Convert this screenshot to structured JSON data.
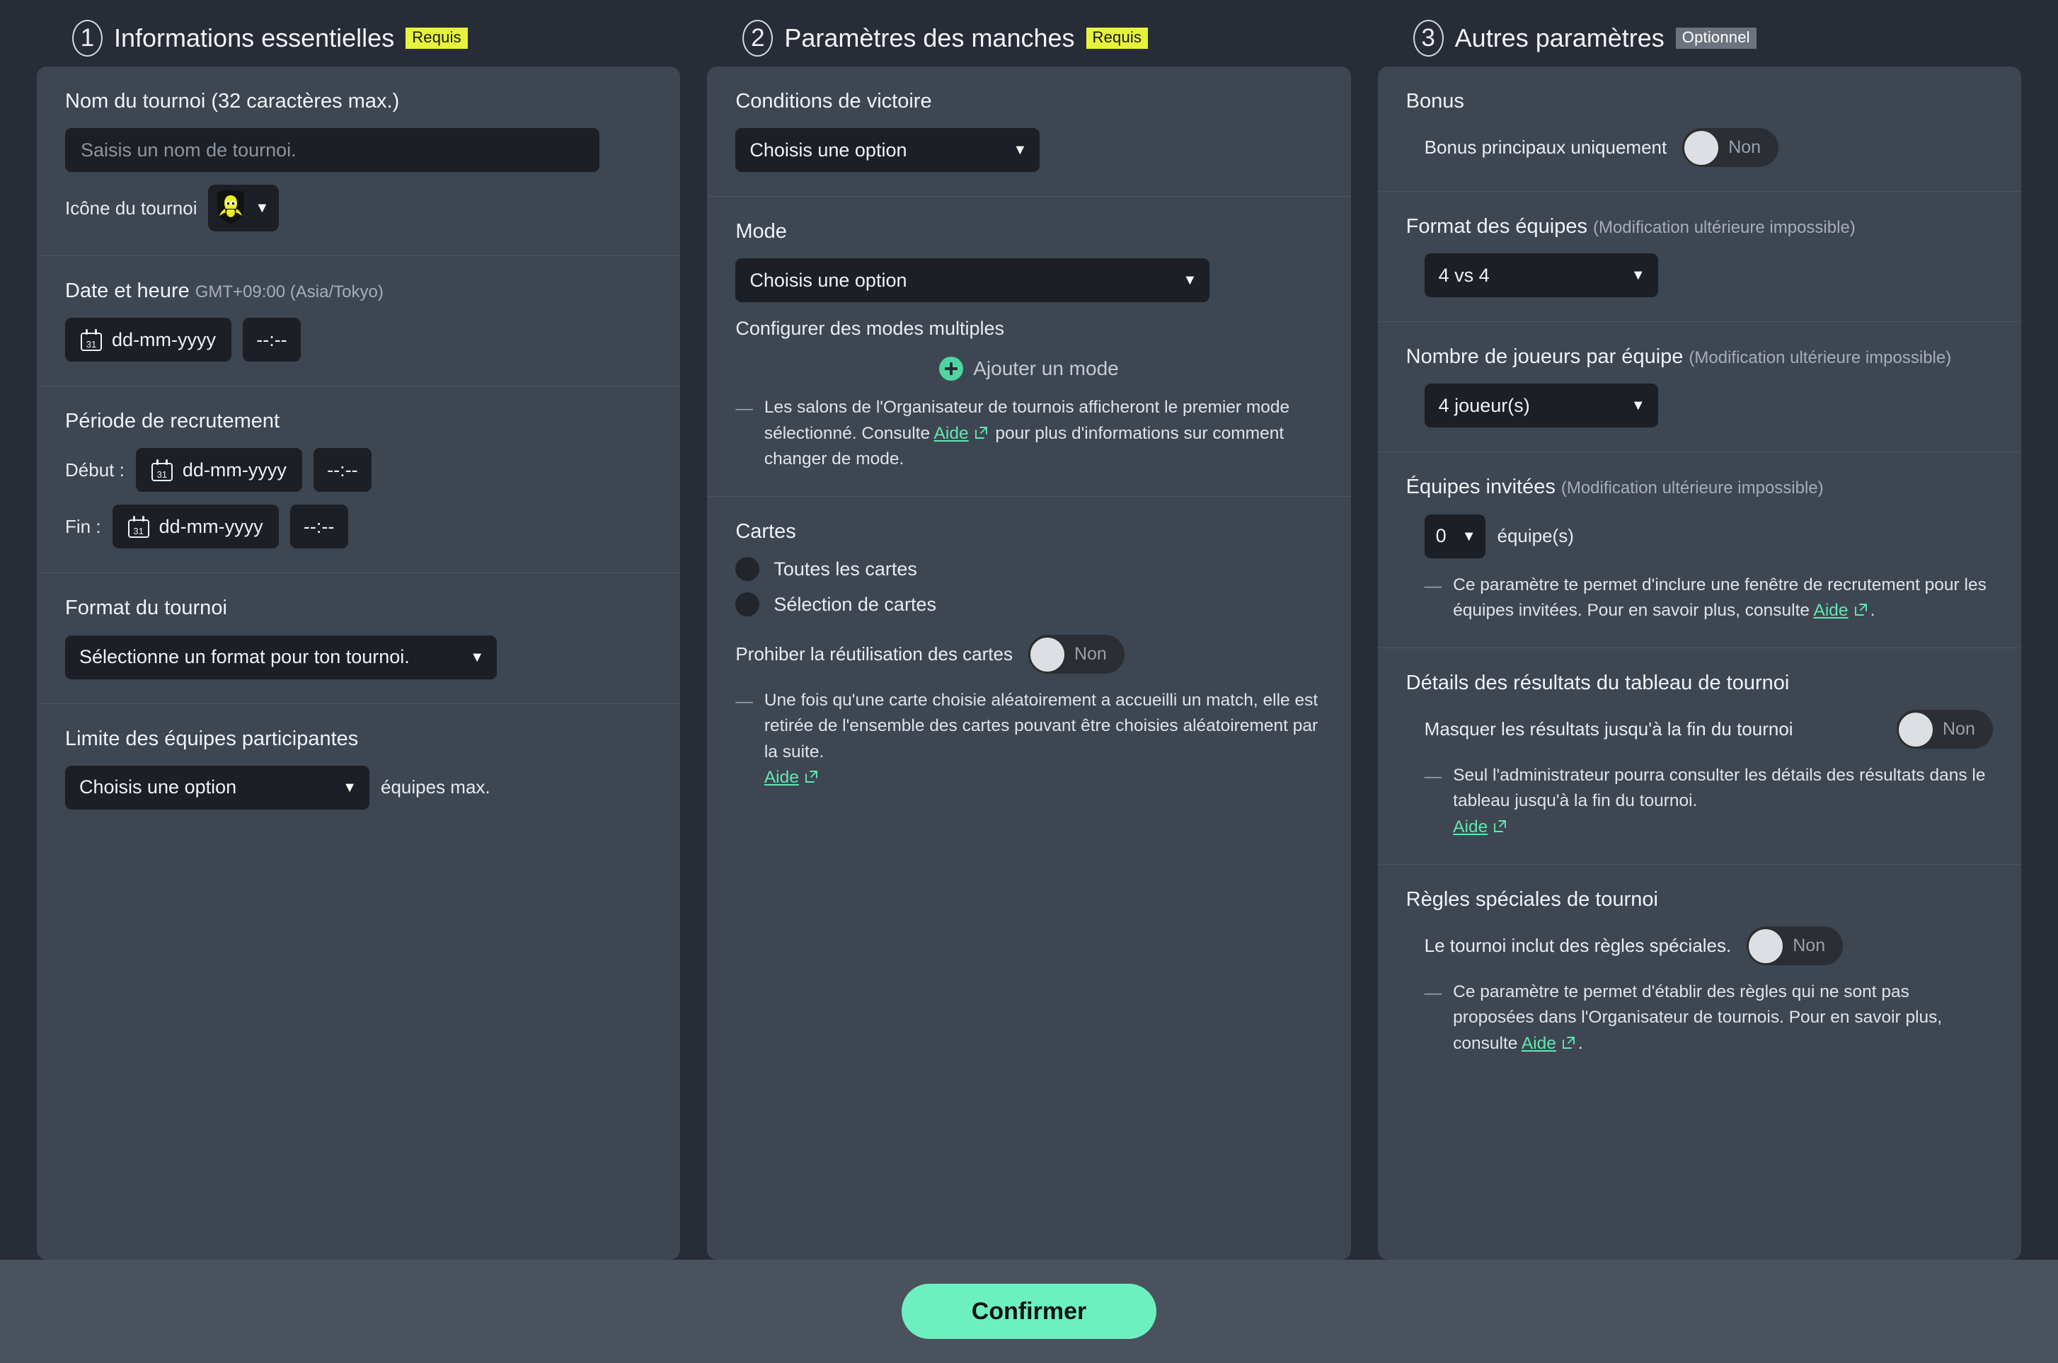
{
  "sections": [
    {
      "number": "1",
      "title": "Informations essentielles",
      "badge": "Requis"
    },
    {
      "number": "2",
      "title": "Paramètres des manches",
      "badge": "Requis"
    },
    {
      "number": "3",
      "title": "Autres paramètres",
      "badge": "Optionnel"
    }
  ],
  "col1": {
    "name": {
      "title": "Nom du tournoi (32 caractères max.)",
      "placeholder": "Saisis un nom de tournoi.",
      "value": "",
      "icon_label": "Icône du tournoi",
      "icon_caret": "▼"
    },
    "datetime": {
      "title": "Date et heure",
      "timezone": "GMT+09:00 (Asia/Tokyo)",
      "date_placeholder": "dd-mm-yyyy",
      "time_placeholder": "--:--",
      "calendar_day": "31"
    },
    "recruitment": {
      "title": "Période de recrutement",
      "start_label": "Début :",
      "end_label": "Fin :",
      "date_placeholder": "dd-mm-yyyy",
      "time_placeholder": "--:--",
      "calendar_day": "31"
    },
    "format": {
      "title": "Format du tournoi",
      "value": "Sélectionne un format pour ton tournoi.",
      "caret": "▼"
    },
    "teamlimit": {
      "title": "Limite des équipes participantes",
      "value": "Choisis une option",
      "caret": "▼",
      "suffix": "équipes max."
    }
  },
  "col2": {
    "victory": {
      "title": "Conditions de victoire",
      "value": "Choisis une option",
      "caret": "▼"
    },
    "mode": {
      "title": "Mode",
      "value": "Choisis une option",
      "caret": "▼",
      "multi_label": "Configurer des modes multiples",
      "add_label": "Ajouter un mode",
      "note_before": "Les salons de l'Organisateur de tournois afficheront le premier mode sélectionné. Consulte ",
      "note_link": "Aide",
      "note_after": " pour plus d'informations sur comment changer de mode."
    },
    "cards": {
      "title": "Cartes",
      "option_all": "Toutes les cartes",
      "option_selection": "Sélection de cartes",
      "prohibit_label": "Prohiber la réutilisation des cartes",
      "prohibit_state": "Non",
      "note": "Une fois qu'une carte choisie aléatoirement a accueilli un match, elle est retirée de l'ensemble des cartes pouvant être choisies aléatoirement par la suite.",
      "note_link": "Aide"
    }
  },
  "col3": {
    "bonus": {
      "title": "Bonus",
      "label": "Bonus principaux uniquement",
      "state": "Non"
    },
    "team_format": {
      "title": "Format des équipes",
      "sub": "(Modification ultérieure impossible)",
      "value": "4 vs 4",
      "caret": "▼"
    },
    "players_per_team": {
      "title": "Nombre de joueurs par équipe",
      "sub": "(Modification ultérieure impossible)",
      "value": "4 joueur(s)",
      "caret": "▼"
    },
    "invited_teams": {
      "title": "Équipes invitées",
      "sub": "(Modification ultérieure impossible)",
      "value": "0",
      "caret": "▼",
      "suffix": "équipe(s)",
      "note_before": "Ce paramètre te permet d'inclure une fenêtre de recrutement pour les équipes invitées. Pour en savoir plus, consulte ",
      "note_link": "Aide",
      "note_after": "."
    },
    "results": {
      "title": "Détails des résultats du tableau de tournoi",
      "label": "Masquer les résultats jusqu'à la fin du tournoi",
      "state": "Non",
      "note": "Seul l'administrateur pourra consulter les détails des résultats dans le tableau jusqu'à la fin du tournoi.",
      "note_link": "Aide"
    },
    "special_rules": {
      "title": "Règles spéciales de tournoi",
      "label": "Le tournoi inclut des règles spéciales.",
      "state": "Non",
      "note_before": "Ce paramètre te permet d'établir des règles qui ne sont pas proposées dans l'Organisateur de tournois. Pour en savoir plus, consulte ",
      "note_link": "Aide",
      "note_after": "."
    }
  },
  "footer": {
    "confirm_label": "Confirmer"
  },
  "colors": {
    "page_bg": "#282c36",
    "card_bg": "#3e4651",
    "field_bg": "#1c1f25",
    "accent_green": "#6df0bf",
    "link_green": "#5fe7b2",
    "badge_required": "#e6f33c",
    "badge_optional": "#6d737e",
    "footer_bg": "#4a525e"
  }
}
